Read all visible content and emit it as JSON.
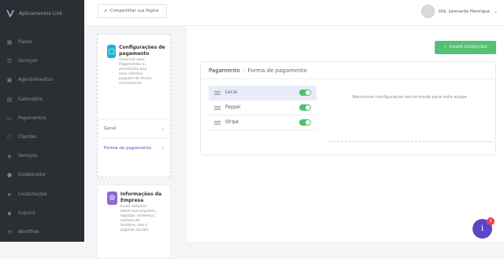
{
  "app": {
    "logo_text": "Aplicamentos Link"
  },
  "sidebar": {
    "items": [
      {
        "label": "Painel",
        "icon": "dashboard-icon"
      },
      {
        "label": "Serviços",
        "icon": "services-icon"
      },
      {
        "label": "Agendamentos",
        "icon": "calendar-icon"
      },
      {
        "label": "Calendário",
        "icon": "calendar-grid-icon"
      },
      {
        "label": "Pagamentos",
        "icon": "wallet-icon"
      },
      {
        "label": "Clientes",
        "icon": "users-icon"
      },
      {
        "label": "Serviços",
        "icon": "layers-icon"
      },
      {
        "label": "Colaborador",
        "icon": "person-icon"
      },
      {
        "label": "Localizações",
        "icon": "location-icon"
      },
      {
        "label": "Cupons",
        "icon": "tag-icon"
      },
      {
        "label": "Workflow",
        "icon": "workflow-icon"
      }
    ]
  },
  "topbar": {
    "share_label": "Compartilhar sua Página",
    "user_name": "Olá, Leonardo Henrique"
  },
  "settings_card": {
    "title": "Configurações de pagamento",
    "description": "Gerencie seus Pagamentos e, permitindo que seus clientes paguem de forma conveniente.",
    "links": [
      {
        "label": "Geral"
      },
      {
        "label": "Forma de pagamento"
      }
    ]
  },
  "company_card": {
    "title": "Informações da Empresa",
    "description": "Insira detalhes sobre sua empresa, logotipo, endereço, número de telefone, site e páginas sociais."
  },
  "main": {
    "save_label": "SALVAR ALTERAÇÕES",
    "breadcrumb_root": "Pagamento",
    "breadcrumb_separator": "›",
    "breadcrumb_current": "Forma de pagamento",
    "methods": [
      {
        "name": "Local",
        "enabled": true
      },
      {
        "name": "Paypal",
        "enabled": true
      },
      {
        "name": "Stripe",
        "enabled": true
      }
    ],
    "empty_message": "Nenhuma configuração encontrada para esta etapa"
  },
  "help": {
    "badge_count": "3",
    "icon": "help-icon"
  },
  "colors": {
    "accent": "#3e57c7",
    "success": "#54c076",
    "sidebar_bg": "#2b2e33",
    "toggle_on": "#4cc170"
  }
}
